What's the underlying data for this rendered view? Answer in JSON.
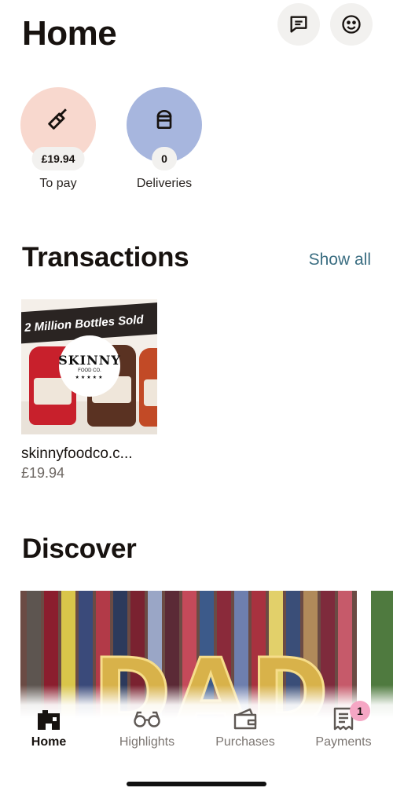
{
  "header": {
    "title": "Home",
    "messages_icon": "message-square-icon",
    "profile_icon": "smiley-face-icon"
  },
  "quick_actions": [
    {
      "label": "To pay",
      "value": "£19.94",
      "icon": "broom-icon",
      "color": "#f8d8ce"
    },
    {
      "label": "Deliveries",
      "value": "0",
      "icon": "package-box-icon",
      "color": "#a7b6de"
    }
  ],
  "transactions": {
    "title": "Transactions",
    "show_all": "Show all",
    "items": [
      {
        "merchant": "skinnyfoodco.c...",
        "amount": "£19.94",
        "image_banner": "2 Million Bottles Sold",
        "logo_text": "SKINNY",
        "logo_sub": "FOOD CO.",
        "logo_stars": "★★★★★"
      }
    ]
  },
  "discover": {
    "title": "Discover",
    "hero_text": "DAD"
  },
  "tabs": [
    {
      "label": "Home",
      "icon": "home-icon",
      "active": true
    },
    {
      "label": "Highlights",
      "icon": "glasses-icon",
      "active": false
    },
    {
      "label": "Purchases",
      "icon": "wallet-icon",
      "active": false
    },
    {
      "label": "Payments",
      "icon": "receipt-icon",
      "active": false,
      "badge": "1"
    }
  ],
  "colors": {
    "accent_link": "#3b6e82",
    "badge": "#f5a6c4",
    "text": "#17120f"
  }
}
